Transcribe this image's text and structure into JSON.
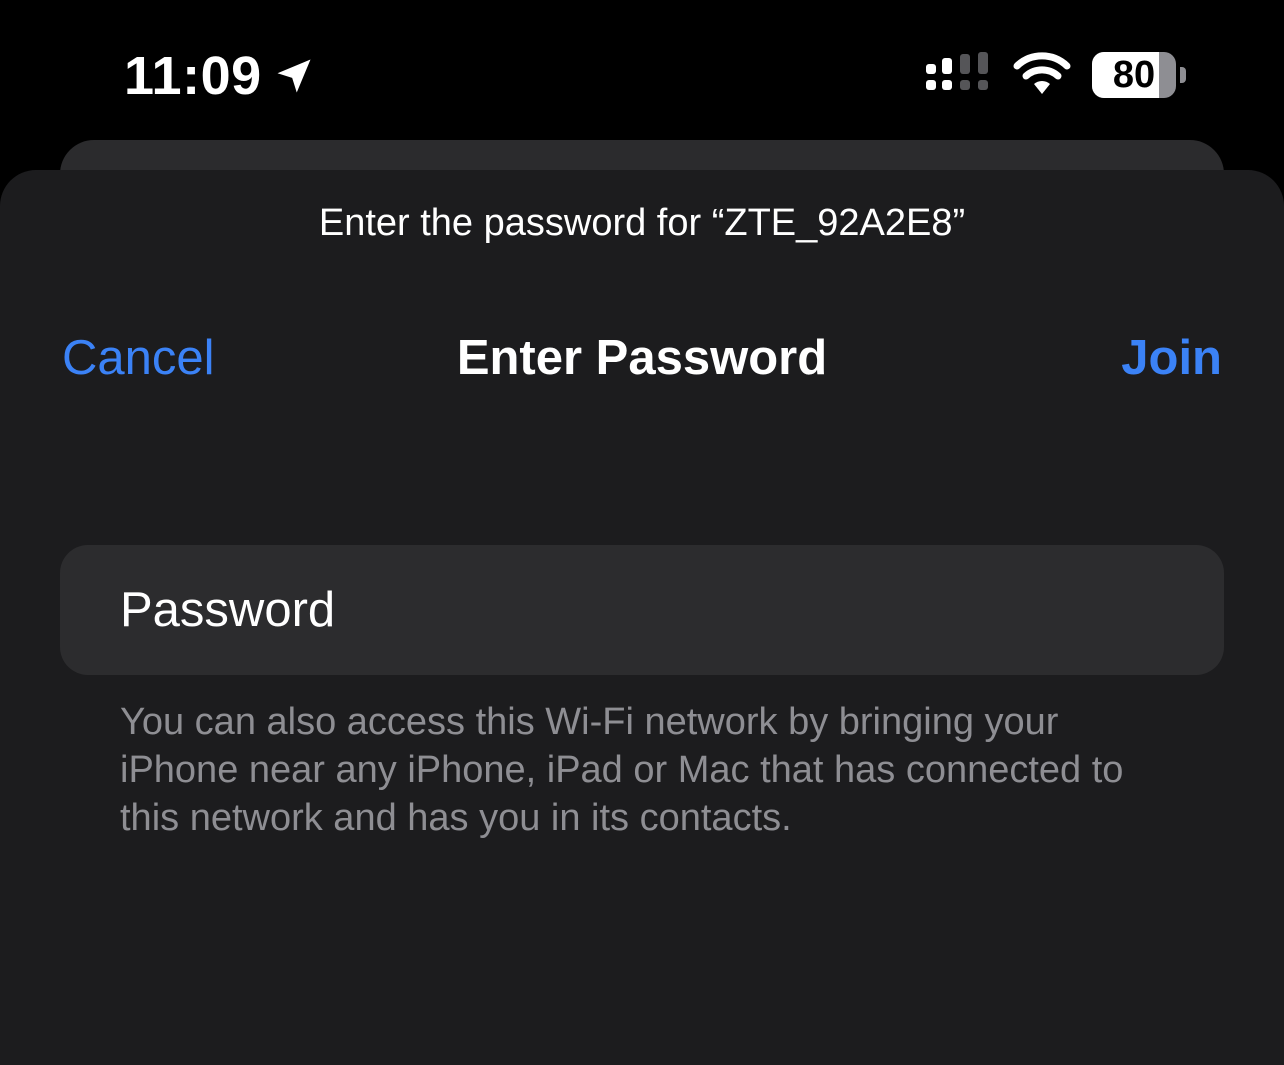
{
  "status_bar": {
    "time": "11:09",
    "battery_level": "80",
    "battery_fraction": 0.8,
    "icons": [
      "location-arrow-icon",
      "cellular-signal-icon",
      "wifi-icon",
      "battery-icon"
    ]
  },
  "sheet": {
    "prompt": "Enter the password for “ZTE_92A2E8”",
    "title": "Enter Password",
    "cancel_label": "Cancel",
    "join_label": "Join",
    "password": {
      "placeholder": "Password",
      "value": ""
    },
    "footnote": "You can also access this Wi-Fi network by bringing your iPhone near any iPhone, iPad or Mac that has connected to this network and has you in its contacts."
  },
  "colors": {
    "accent": "#3b82f6",
    "sheet_background": "#1c1c1e",
    "field_background": "#2c2c2e",
    "secondary_text": "#8e8e93"
  }
}
